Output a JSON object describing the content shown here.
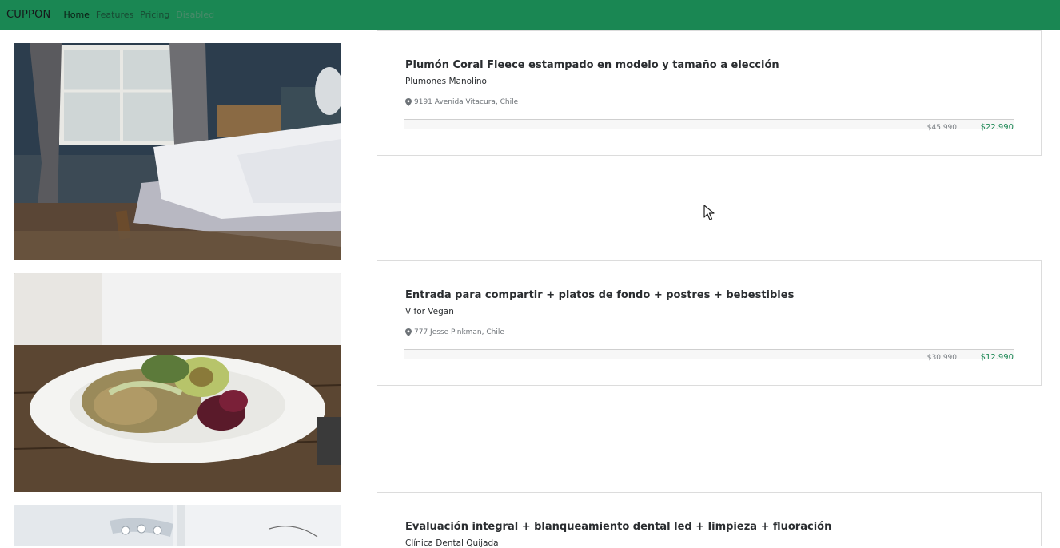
{
  "navbar": {
    "brand": "CUPPON",
    "links": [
      "Home",
      "Features",
      "Pricing",
      "Disabled"
    ]
  },
  "deals": [
    {
      "title": "Plumón Coral Fleece estampado en modelo y tamaño a elección",
      "merchant": "Plumones Manolino",
      "location": "9191 Avenida Vitacura, Chile",
      "old_price": "$45.990",
      "new_price": "$22.990"
    },
    {
      "title": "Entrada para compartir + platos de fondo + postres + bebestibles",
      "merchant": "V for Vegan",
      "location": "777 Jesse Pinkman, Chile",
      "old_price": "$30.990",
      "new_price": "$12.990"
    },
    {
      "title": "Evaluación integral + blanqueamiento dental led + limpieza + fluoración",
      "merchant": "Clínica Dental Quijada"
    }
  ],
  "colors": {
    "navbar": "#1a8753",
    "accent_price": "#1a8753",
    "card_border": "#dcdcdc"
  },
  "icons": {
    "location": "map-pin-icon",
    "cursor": "mouse-pointer"
  }
}
